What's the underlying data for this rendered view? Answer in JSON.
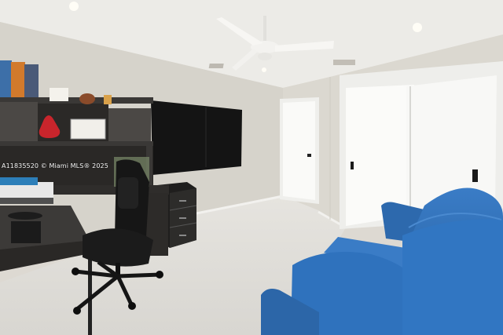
{
  "photo": {
    "watermark": "A11835520 © Miami MLS® 2025"
  },
  "colors": {
    "ceiling": "#ecebe7",
    "wall_left": "#d7d4cd",
    "wall_right": "#dcd9d1",
    "floor": "#e3e1dc",
    "desk": "#2e2c2a",
    "sofa": "#2f6db3",
    "door": "#f7f7f5",
    "tv": "#111111"
  }
}
